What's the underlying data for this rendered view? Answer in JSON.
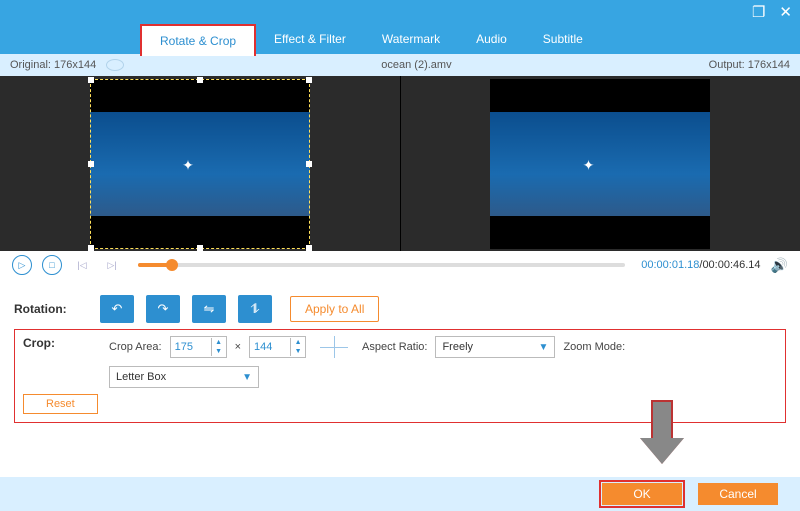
{
  "window": {
    "restore": "❐",
    "close": "✕"
  },
  "tabs": [
    "Rotate & Crop",
    "Effect & Filter",
    "Watermark",
    "Audio",
    "Subtitle"
  ],
  "infobar": {
    "original": "Original: 176x144",
    "filename": "ocean (2).amv",
    "output": "Output: 176x144"
  },
  "transport": {
    "current": "00:00:01.18",
    "total": "00:00:46.14"
  },
  "rotation": {
    "label": "Rotation:",
    "apply_all": "Apply to All"
  },
  "crop": {
    "label": "Crop:",
    "area_label": "Crop Area:",
    "width": "175",
    "times": "×",
    "height": "144",
    "aspect_label": "Aspect Ratio:",
    "aspect_value": "Freely",
    "zoom_label": "Zoom Mode:",
    "zoom_value": "Letter Box",
    "reset": "Reset"
  },
  "footer": {
    "ok": "OK",
    "cancel": "Cancel"
  }
}
